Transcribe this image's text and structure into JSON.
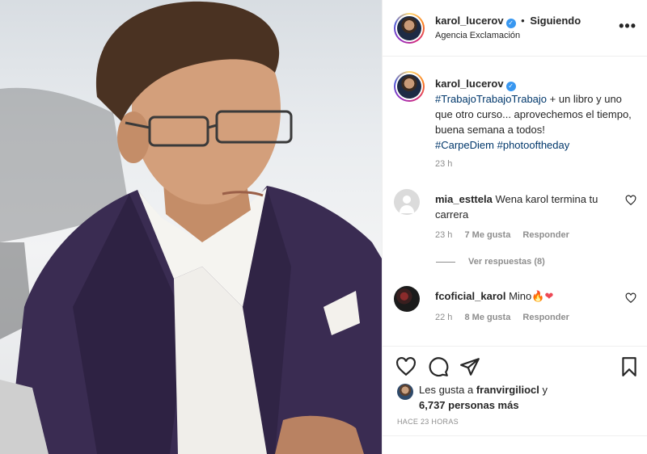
{
  "header": {
    "username": "karol_lucerov",
    "separator": "•",
    "follow_status": "Siguiendo",
    "subtitle": "Agencia Exclamación",
    "more_icon": "more-options-icon"
  },
  "caption": {
    "username": "karol_lucerov",
    "hashtag1": "#TrabajoTrabajoTrabajo",
    "text1": " + un libro y uno que otro curso... aprovechemos el tiempo, buena semana a todos!",
    "hashtag2": "#CarpeDiem",
    "hashtag3": "#photooftheday",
    "time": "23 h"
  },
  "comments": [
    {
      "username": "mia_esttela",
      "text": "Wena karol termina tu carrera",
      "time": "23 h",
      "likes": "7 Me gusta",
      "reply": "Responder"
    },
    {
      "username": "fcoficial_karol",
      "text": "Mino",
      "emoji_fire": "🔥",
      "emoji_heart": "❤",
      "time": "22 h",
      "likes": "8 Me gusta",
      "reply": "Responder"
    }
  ],
  "view_replies": "Ver respuestas (8)",
  "likes": {
    "prefix": "Les gusta a ",
    "user": "franvirgiliocl",
    "joiner": " y",
    "count": "6,737 personas más"
  },
  "posted": "HACE 23 HORAS",
  "colors": {
    "link": "#00376b",
    "verified": "#3897f0",
    "muted": "#8e8e8e",
    "like_heart": "#ed4956"
  }
}
